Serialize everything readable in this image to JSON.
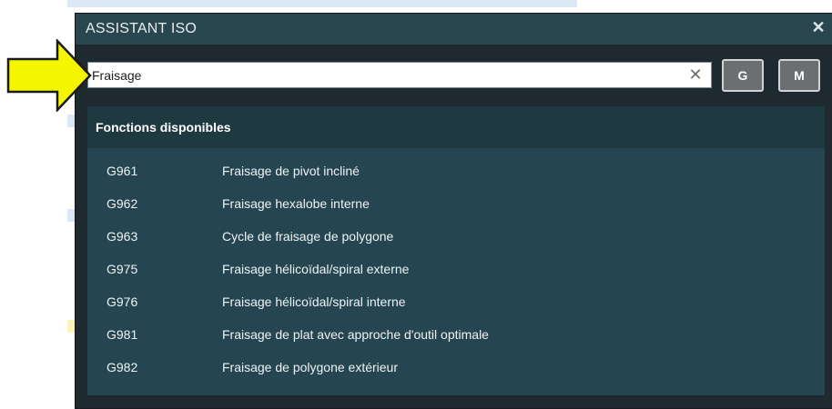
{
  "dialog": {
    "title": "ASSISTANT ISO",
    "close_symbol": "✕"
  },
  "search": {
    "value": "Fraisage",
    "clear_symbol": "✕"
  },
  "buttons": {
    "g_label": "G",
    "m_label": "M"
  },
  "panel": {
    "header": "Fonctions disponibles",
    "functions": [
      {
        "code": "G961",
        "description": "Fraisage de pivot incliné"
      },
      {
        "code": "G962",
        "description": "Fraisage hexalobe interne"
      },
      {
        "code": "G963",
        "description": "Cycle de fraisage de polygone"
      },
      {
        "code": "G975",
        "description": "Fraisage hélicoïdal/spiral externe"
      },
      {
        "code": "G976",
        "description": "Fraisage hélicoïdal/spiral interne"
      },
      {
        "code": "G981",
        "description": "Fraisage de plat avec approche d'outil optimale"
      },
      {
        "code": "G982",
        "description": "Fraisage de polygone extérieur"
      }
    ]
  },
  "colors": {
    "title_bar": "#2a4750",
    "panel": "#254650",
    "panel_header": "#1f3940",
    "annotation_arrow": "#f5f500"
  },
  "icons": {
    "annotation": "arrow-right-icon",
    "close": "close-icon",
    "clear": "clear-icon"
  }
}
